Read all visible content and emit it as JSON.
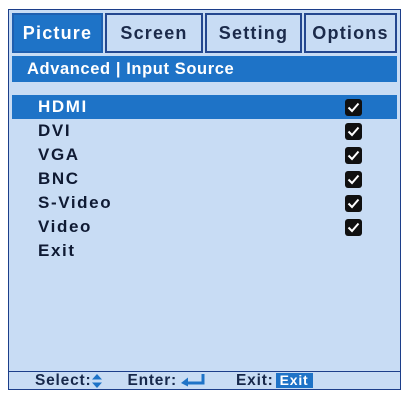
{
  "tabs": [
    {
      "label": "Picture",
      "active": true
    },
    {
      "label": "Screen",
      "active": false
    },
    {
      "label": "Setting",
      "active": false
    },
    {
      "label": "Options",
      "active": false
    }
  ],
  "breadcrumb": "Advanced | Input Source",
  "items": [
    {
      "label": "HDMI",
      "checked": true,
      "selected": true
    },
    {
      "label": "DVI",
      "checked": true,
      "selected": false
    },
    {
      "label": "VGA",
      "checked": true,
      "selected": false
    },
    {
      "label": "BNC",
      "checked": true,
      "selected": false
    },
    {
      "label": "S-Video",
      "checked": true,
      "selected": false
    },
    {
      "label": "Video",
      "checked": true,
      "selected": false
    },
    {
      "label": "Exit",
      "checked": false,
      "selected": false
    }
  ],
  "footer": {
    "select_label": "Select:",
    "enter_label": "Enter:",
    "exit_label": "Exit:",
    "exit_badge": "Exit",
    "select_icon": "up-down-arrows-icon",
    "enter_icon": "enter-return-icon"
  },
  "colors": {
    "accent": "#1e73c7",
    "panel": "#c8dcf4",
    "border": "#1c3e8a"
  }
}
